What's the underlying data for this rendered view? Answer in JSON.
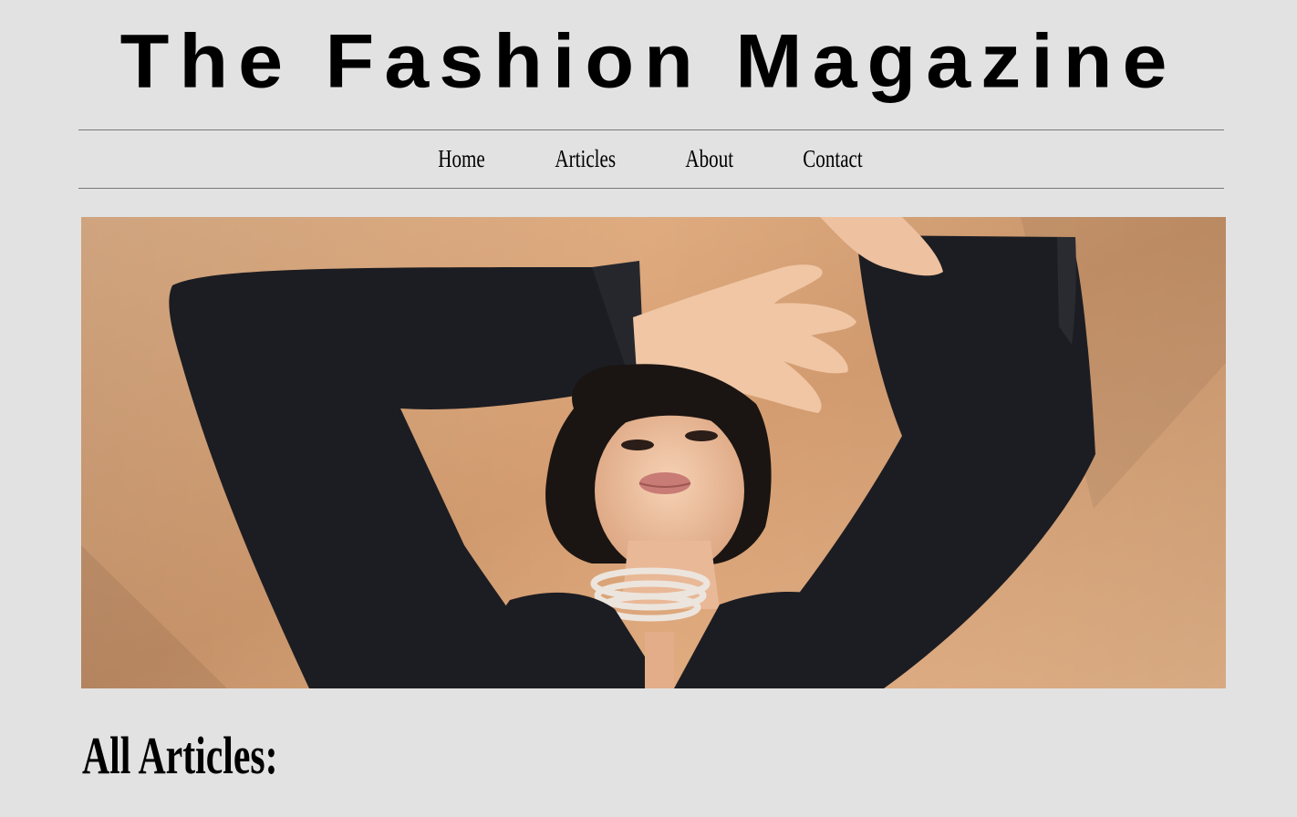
{
  "header": {
    "title": "The Fashion Magazine"
  },
  "nav": {
    "items": [
      {
        "label": "Home"
      },
      {
        "label": "Articles"
      },
      {
        "label": "About"
      },
      {
        "label": "Contact"
      }
    ]
  },
  "hero": {
    "image_subject": "fashion-model-photo",
    "colors": {
      "background": "#dda578",
      "blazer": "#1c1d22",
      "skin": "#f0c8a8",
      "hair": "#1a1512"
    }
  },
  "main": {
    "section_heading": "All Articles:"
  },
  "colors": {
    "page_background": "#e2e2e2",
    "text": "#000000",
    "rule": "#7a7a7a"
  }
}
